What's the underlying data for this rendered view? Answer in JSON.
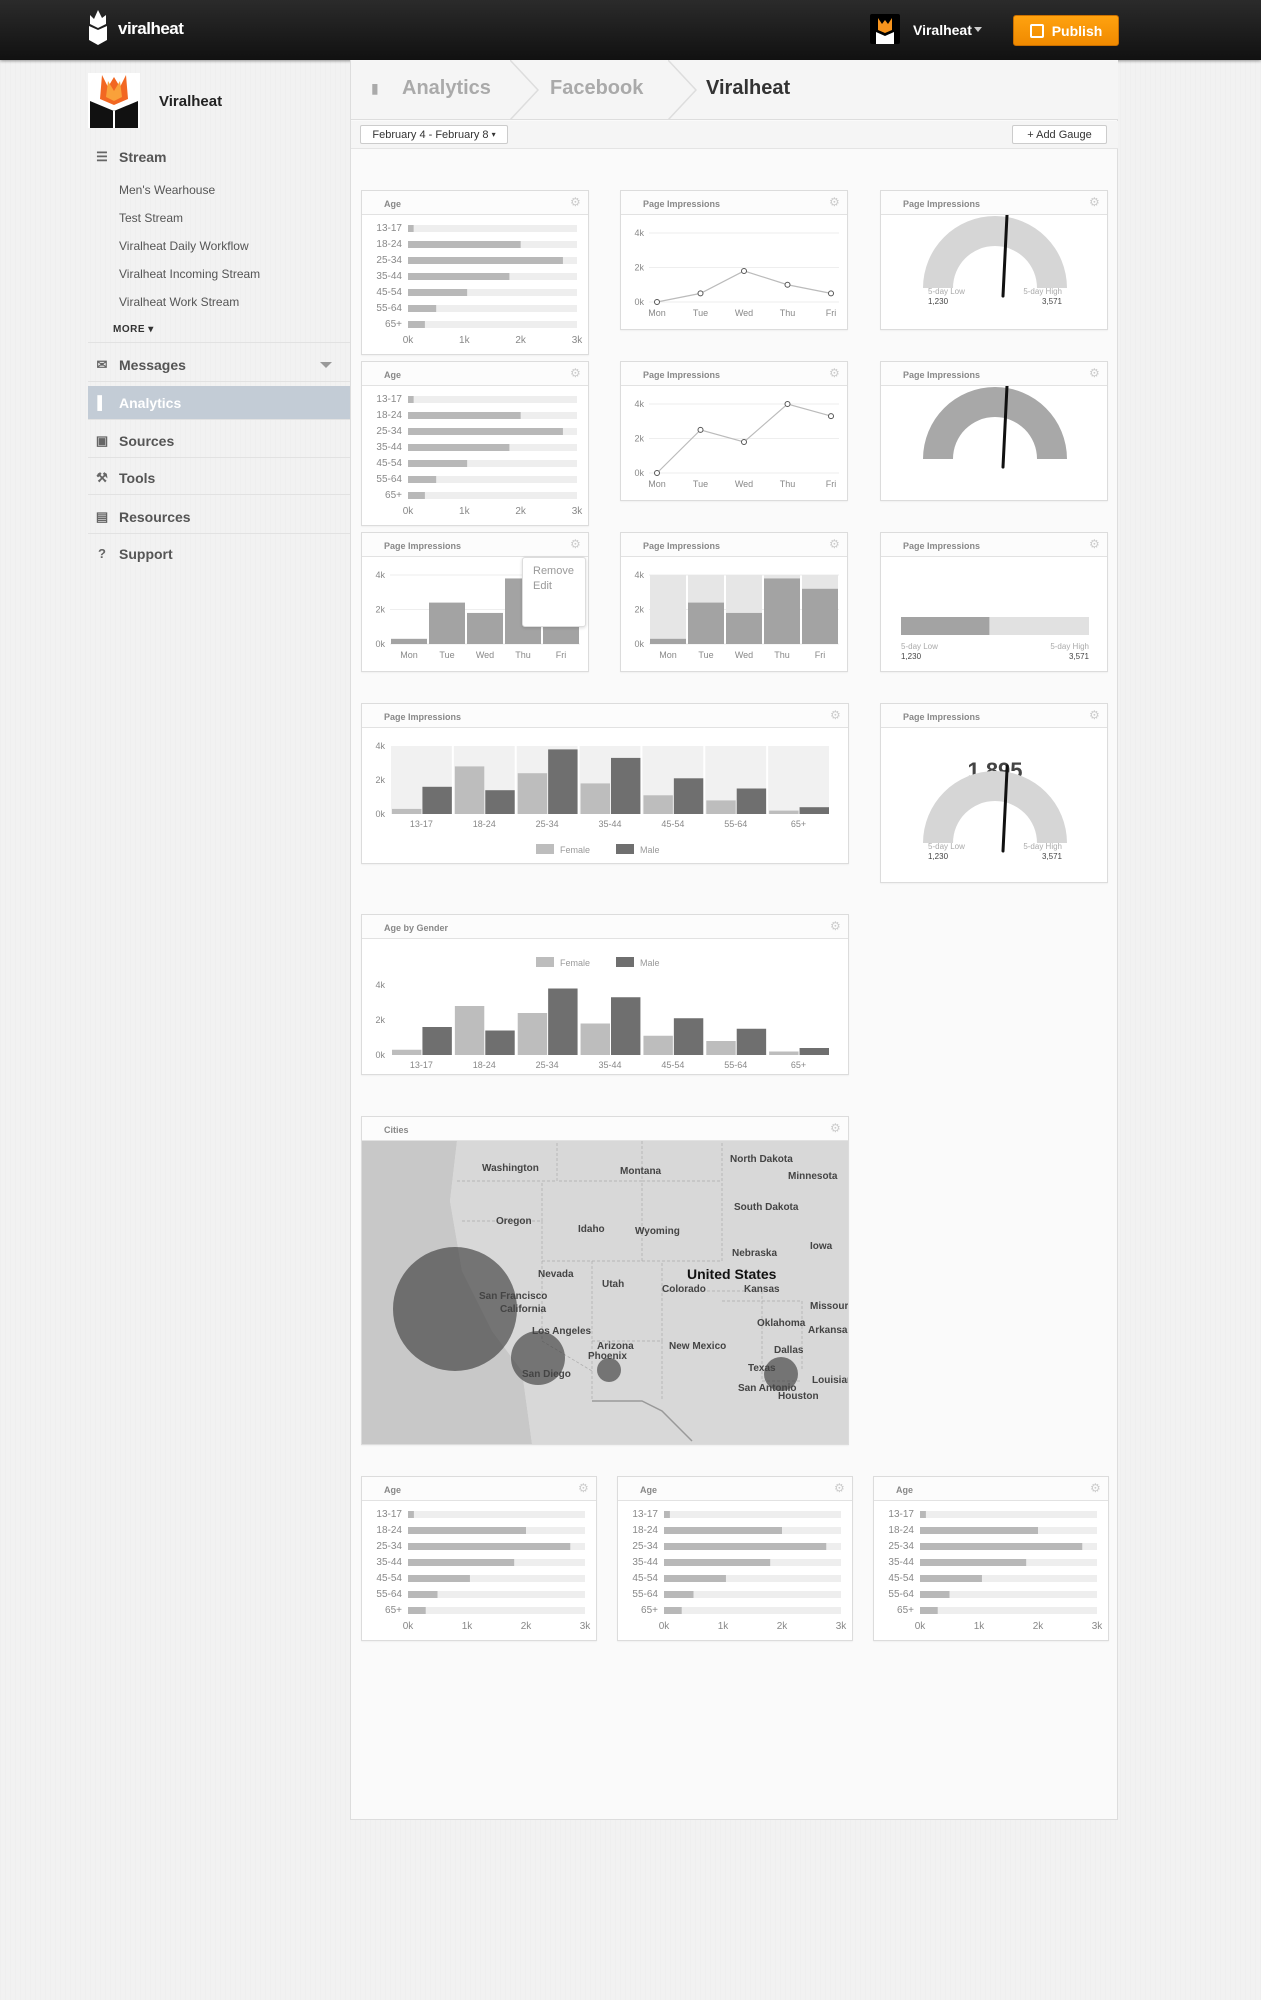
{
  "topbar": {
    "brand": "viralheat",
    "account": "Viralheat",
    "publish": "Publish"
  },
  "sidebar": {
    "title": "Viralheat",
    "stream": "Stream",
    "subitems": [
      "Men's Wearhouse",
      "Test Stream",
      "Viralheat Daily Workflow",
      "Viralheat Incoming Stream",
      "Viralheat Work Stream"
    ],
    "more": "MORE",
    "items": [
      {
        "label": "Messages",
        "icon": "envelope-icon"
      },
      {
        "label": "Analytics",
        "icon": "bar-chart-icon"
      },
      {
        "label": "Sources",
        "icon": "inbox-icon"
      },
      {
        "label": "Tools",
        "icon": "wrench-icon"
      },
      {
        "label": "Resources",
        "icon": "book-icon"
      },
      {
        "label": "Support",
        "icon": "question-icon"
      }
    ]
  },
  "breadcrumb": [
    "Analytics",
    "Facebook",
    "Viralheat"
  ],
  "toolbar": {
    "date_range": "February 4 - February 8",
    "add_gauge": "+ Add Gauge"
  },
  "widget_menu": {
    "remove": "Remove",
    "edit": "Edit"
  },
  "colors": {
    "accent": "#f7941d",
    "bar_light": "#bdbdbd",
    "bar_dark": "#6f6f6f",
    "active_nav": "#c3ccd6"
  },
  "chart_data": [
    {
      "id": "age1",
      "type": "bar",
      "title": "Age",
      "orientation": "horizontal",
      "categories": [
        "13-17",
        "18-24",
        "25-34",
        "35-44",
        "45-54",
        "55-64",
        "65+"
      ],
      "values": [
        0.1,
        2.0,
        2.75,
        1.8,
        1.05,
        0.5,
        0.3
      ],
      "xticks": [
        "0k",
        "1k",
        "2k",
        "3k"
      ],
      "xlim": [
        0,
        3
      ]
    },
    {
      "id": "line1",
      "type": "line",
      "title": "Page Impressions",
      "categories": [
        "Mon",
        "Tue",
        "Wed",
        "Thu",
        "Fri"
      ],
      "values": [
        0,
        0.5,
        1.8,
        1.0,
        0.5
      ],
      "yticks": [
        "4k",
        "2k",
        "0k"
      ],
      "ylim": [
        0,
        4
      ]
    },
    {
      "id": "gauge1",
      "type": "gauge",
      "title": "Page Impressions",
      "low_label": "5-day Low",
      "low": "1,230",
      "high_label": "5-day High",
      "high": "3,571",
      "fraction": 0.55
    },
    {
      "id": "age2",
      "type": "bar",
      "title": "Age",
      "orientation": "horizontal",
      "categories": [
        "13-17",
        "18-24",
        "25-34",
        "35-44",
        "45-54",
        "55-64",
        "65+"
      ],
      "values": [
        0.1,
        2.0,
        2.75,
        1.8,
        1.05,
        0.5,
        0.3
      ],
      "xticks": [
        "0k",
        "1k",
        "2k",
        "3k"
      ],
      "xlim": [
        0,
        3
      ]
    },
    {
      "id": "line2",
      "type": "line",
      "title": "Page Impressions",
      "categories": [
        "Mon",
        "Tue",
        "Wed",
        "Thu",
        "Fri"
      ],
      "values": [
        0,
        2.5,
        1.8,
        4.0,
        3.3
      ],
      "yticks": [
        "4k",
        "2k",
        "0k"
      ],
      "ylim": [
        0,
        4
      ]
    },
    {
      "id": "gauge2",
      "type": "gauge",
      "title": "Page Impressions",
      "fraction": 0.55
    },
    {
      "id": "bar1",
      "type": "bar",
      "title": "Page Impressions",
      "categories": [
        "Mon",
        "Tue",
        "Wed",
        "Thu",
        "Fri"
      ],
      "values": [
        0.3,
        2.4,
        1.8,
        3.8,
        3.2
      ],
      "yticks": [
        "4k",
        "2k",
        "0k"
      ],
      "ylim": [
        0,
        4
      ]
    },
    {
      "id": "bar2",
      "type": "bar",
      "title": "Page Impressions",
      "categories": [
        "Mon",
        "Tue",
        "Wed",
        "Thu",
        "Fri"
      ],
      "values": [
        0.3,
        2.4,
        1.8,
        3.8,
        3.2
      ],
      "yticks": [
        "4k",
        "2k",
        "0k"
      ],
      "ylim": [
        0,
        4
      ]
    },
    {
      "id": "hbar1",
      "type": "progress",
      "title": "Page Impressions",
      "low_label": "5-day Low",
      "low": "1,230",
      "high_label": "5-day High",
      "high": "3,571",
      "fraction": 0.47
    },
    {
      "id": "grp1",
      "type": "bar",
      "title": "Page Impressions",
      "categories": [
        "13-17",
        "18-24",
        "25-34",
        "35-44",
        "45-54",
        "55-64",
        "65+"
      ],
      "series": [
        {
          "name": "Female",
          "values": [
            0.3,
            2.8,
            2.4,
            1.8,
            1.1,
            0.8,
            0.2
          ]
        },
        {
          "name": "Male",
          "values": [
            1.6,
            1.4,
            3.8,
            3.3,
            2.1,
            1.5,
            0.4
          ]
        }
      ],
      "yticks": [
        "4k",
        "2k",
        "0k"
      ],
      "ylim": [
        0,
        4
      ]
    },
    {
      "id": "gauge3",
      "type": "gauge",
      "title": "Page Impressions",
      "value": "1,895",
      "low_label": "5-day Low",
      "low": "1,230",
      "high_label": "5-day High",
      "high": "3,571",
      "fraction": 0.55
    },
    {
      "id": "grp2",
      "type": "bar",
      "title": "Age by Gender",
      "categories": [
        "13-17",
        "18-24",
        "25-34",
        "35-44",
        "45-54",
        "55-64",
        "65+"
      ],
      "series": [
        {
          "name": "Female",
          "values": [
            0.3,
            2.8,
            2.4,
            1.8,
            1.1,
            0.8,
            0.2
          ]
        },
        {
          "name": "Male",
          "values": [
            1.6,
            1.4,
            3.8,
            3.3,
            2.1,
            1.5,
            0.4
          ]
        }
      ],
      "yticks": [
        "4k",
        "2k",
        "0k"
      ],
      "ylim": [
        0,
        4
      ]
    },
    {
      "id": "age3",
      "type": "bar",
      "title": "Age",
      "orientation": "horizontal",
      "categories": [
        "13-17",
        "18-24",
        "25-34",
        "35-44",
        "45-54",
        "55-64",
        "65+"
      ],
      "values": [
        0.1,
        2.0,
        2.75,
        1.8,
        1.05,
        0.5,
        0.3
      ],
      "xticks": [
        "0k",
        "1k",
        "2k",
        "3k"
      ],
      "xlim": [
        0,
        3
      ]
    },
    {
      "id": "age4",
      "type": "bar",
      "title": "Age",
      "orientation": "horizontal",
      "categories": [
        "13-17",
        "18-24",
        "25-34",
        "35-44",
        "45-54",
        "55-64",
        "65+"
      ],
      "values": [
        0.1,
        2.0,
        2.75,
        1.8,
        1.05,
        0.5,
        0.3
      ],
      "xticks": [
        "0k",
        "1k",
        "2k",
        "3k"
      ],
      "xlim": [
        0,
        3
      ]
    },
    {
      "id": "age5",
      "type": "bar",
      "title": "Age",
      "orientation": "horizontal",
      "categories": [
        "13-17",
        "18-24",
        "25-34",
        "35-44",
        "45-54",
        "55-64",
        "65+"
      ],
      "values": [
        0.1,
        2.0,
        2.75,
        1.8,
        1.05,
        0.5,
        0.3
      ],
      "xticks": [
        "0k",
        "1k",
        "2k",
        "3k"
      ],
      "xlim": [
        0,
        3
      ]
    }
  ],
  "map": {
    "title": "Cities",
    "labels": [
      "Washington",
      "Montana",
      "North Dakota",
      "Minnesota",
      "Oregon",
      "Idaho",
      "Wyoming",
      "South Dakota",
      "Nebraska",
      "Iowa",
      "Nevada",
      "Utah",
      "Colorado",
      "United States",
      "Kansas",
      "Missouri",
      "San Francisco",
      "California",
      "Arizona",
      "New Mexico",
      "Oklahoma",
      "Arkansas",
      "Los Angeles",
      "Phoenix",
      "Dallas",
      "Texas",
      "San Diego",
      "San Antonio",
      "Houston",
      "Louisiana"
    ]
  }
}
